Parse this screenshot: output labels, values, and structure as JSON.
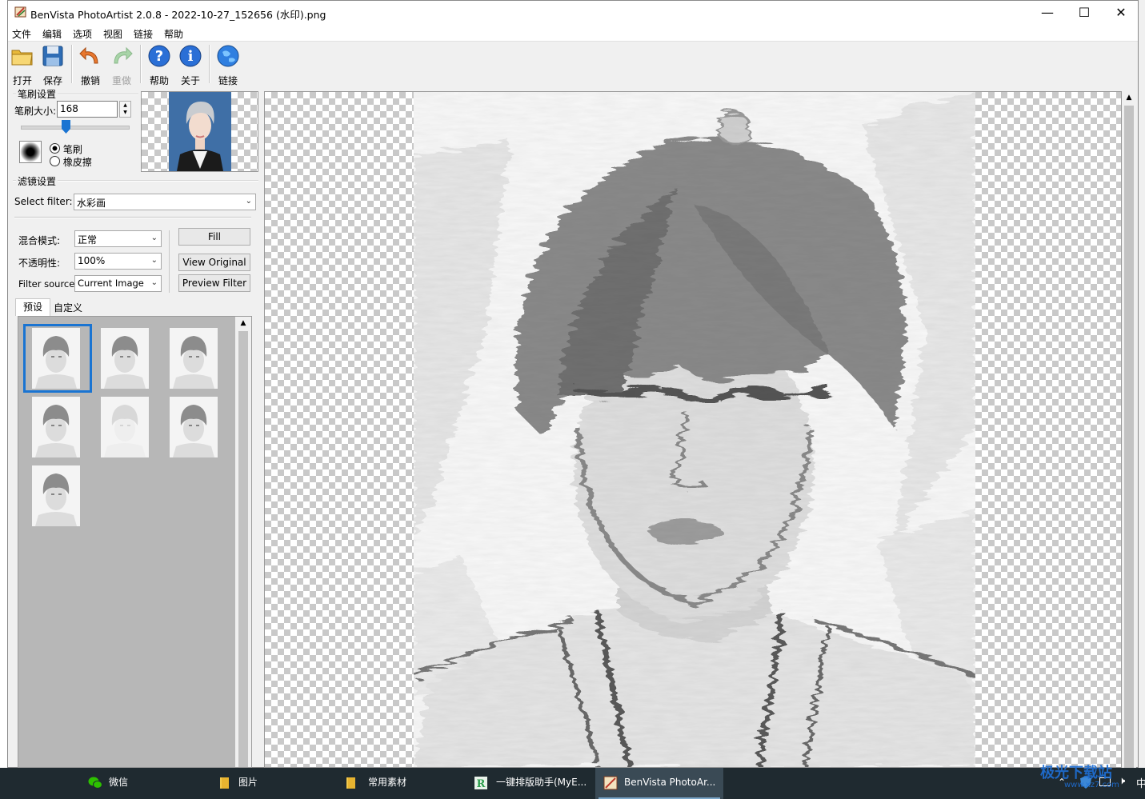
{
  "window": {
    "title": "BenVista PhotoArtist 2.0.8 - 2022-10-27_152656 (水印).png",
    "minimize_glyph": "—",
    "maximize_glyph": "☐",
    "close_glyph": "✕"
  },
  "menu": [
    "文件",
    "编辑",
    "选项",
    "视图",
    "链接",
    "帮助"
  ],
  "toolbar": {
    "open": "打开",
    "save": "保存",
    "undo": "撤销",
    "redo": "重做",
    "help": "帮助",
    "about": "关于",
    "link": "链接"
  },
  "brush": {
    "group_label": "笔刷设置",
    "size_label": "笔刷大小:",
    "size_value": "168",
    "mode_brush": "笔刷",
    "mode_eraser": "橡皮擦",
    "selected_mode": "brush"
  },
  "filter": {
    "group_label": "滤镜设置",
    "select_label": "Select filter:",
    "select_value": "水彩画",
    "blend_label": "混合模式:",
    "blend_value": "正常",
    "opacity_label": "不透明性:",
    "opacity_value": "100%",
    "source_label": "Filter source:",
    "source_value": "Current Image",
    "fill_button": "Fill",
    "view_original_button": "View Original",
    "preview_button": "Preview Filter"
  },
  "tabs": [
    "预设",
    "自定义"
  ],
  "presets": {
    "count": 7,
    "selected_index": 0
  },
  "taskbar": {
    "items": [
      {
        "label": "微信",
        "icon": "wechat-icon"
      },
      {
        "label": "图片",
        "icon": "folder-icon"
      },
      {
        "label": "常用素材",
        "icon": "folder-icon"
      },
      {
        "label": "一键排版助手(MyE...",
        "icon": "app-icon"
      },
      {
        "label": "BenVista PhotoAr...",
        "icon": "photoartist-icon",
        "active": true
      }
    ],
    "watermark_text": "极光下载站",
    "watermark_sub": "www.xz7.com"
  },
  "colors": {
    "selection_border": "#1a74d2",
    "taskbar": "#1f2a30"
  }
}
